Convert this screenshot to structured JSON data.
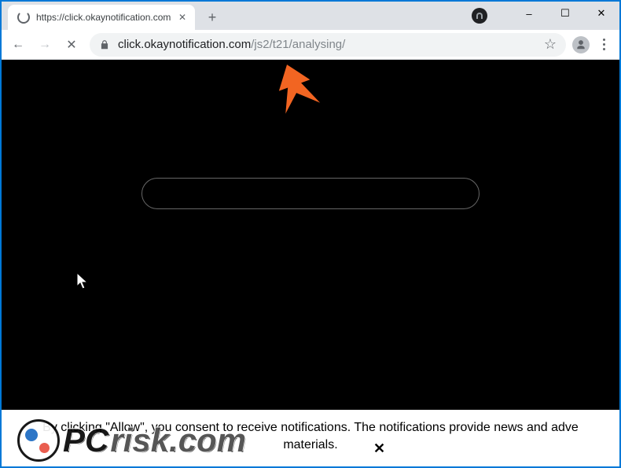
{
  "window": {
    "minimize_glyph": "–",
    "maximize_glyph": "☐",
    "close_glyph": "✕"
  },
  "tab": {
    "title": "https://click.okaynotification.com",
    "close_glyph": "✕",
    "newtab_glyph": "+"
  },
  "nav": {
    "back_glyph": "←",
    "forward_glyph": "→",
    "stop_glyph": "✕"
  },
  "address": {
    "host": "click.okaynotification.com",
    "path": "/js2/t21/analysing/",
    "star_glyph": "☆"
  },
  "page": {
    "consent_line1": "By clicking \"Allow\", you consent to receive notifications. The notifications provide news and adve",
    "consent_line2": "materials.",
    "consent_close_glyph": "✕"
  },
  "watermark": {
    "prefix": "PC",
    "suffix": "risk.com"
  }
}
